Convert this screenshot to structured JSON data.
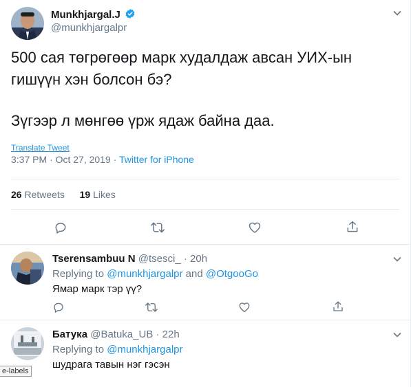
{
  "main_tweet": {
    "author_name": "Munkhjargal.J",
    "handle": "@munkhjargalpr",
    "text_line1": "500 сая төгрөгөөр марк худалдаж авсан УИХ-ын",
    "text_line2": "гишүүн хэн болсон бэ?",
    "text_line3": "Зүгээр л мөнгөө үрж ядаж байна даа.",
    "translate": "Translate Tweet",
    "time": "3:37 PM · Oct 27, 2019 · ",
    "source": "Twitter for iPhone",
    "retweets_count": "26",
    "retweets_label": "Retweets",
    "likes_count": "19",
    "likes_label": "Likes"
  },
  "replies": [
    {
      "author_name": "Tserensambuu N",
      "handle": "@tsesci_",
      "time": "· 20h",
      "replying_prefix": "Replying to ",
      "replying_to1": "@munkhjargalpr",
      "replying_and": " and ",
      "replying_to2": "@OtgooGo",
      "text": "Ямар марк тэр үү?"
    },
    {
      "author_name": "Батука",
      "handle": "@Batuka_UB",
      "time": "· 22h",
      "replying_prefix": "Replying to ",
      "replying_to1": "@munkhjargalpr",
      "text": "шудрага тавын нэг гэсэн"
    }
  ],
  "tooltip": "e-labels",
  "colors": {
    "link": "#1b95e0",
    "muted": "#657786",
    "text": "#14171a",
    "border": "#e6ecf0",
    "verified": "#1da1f2"
  }
}
